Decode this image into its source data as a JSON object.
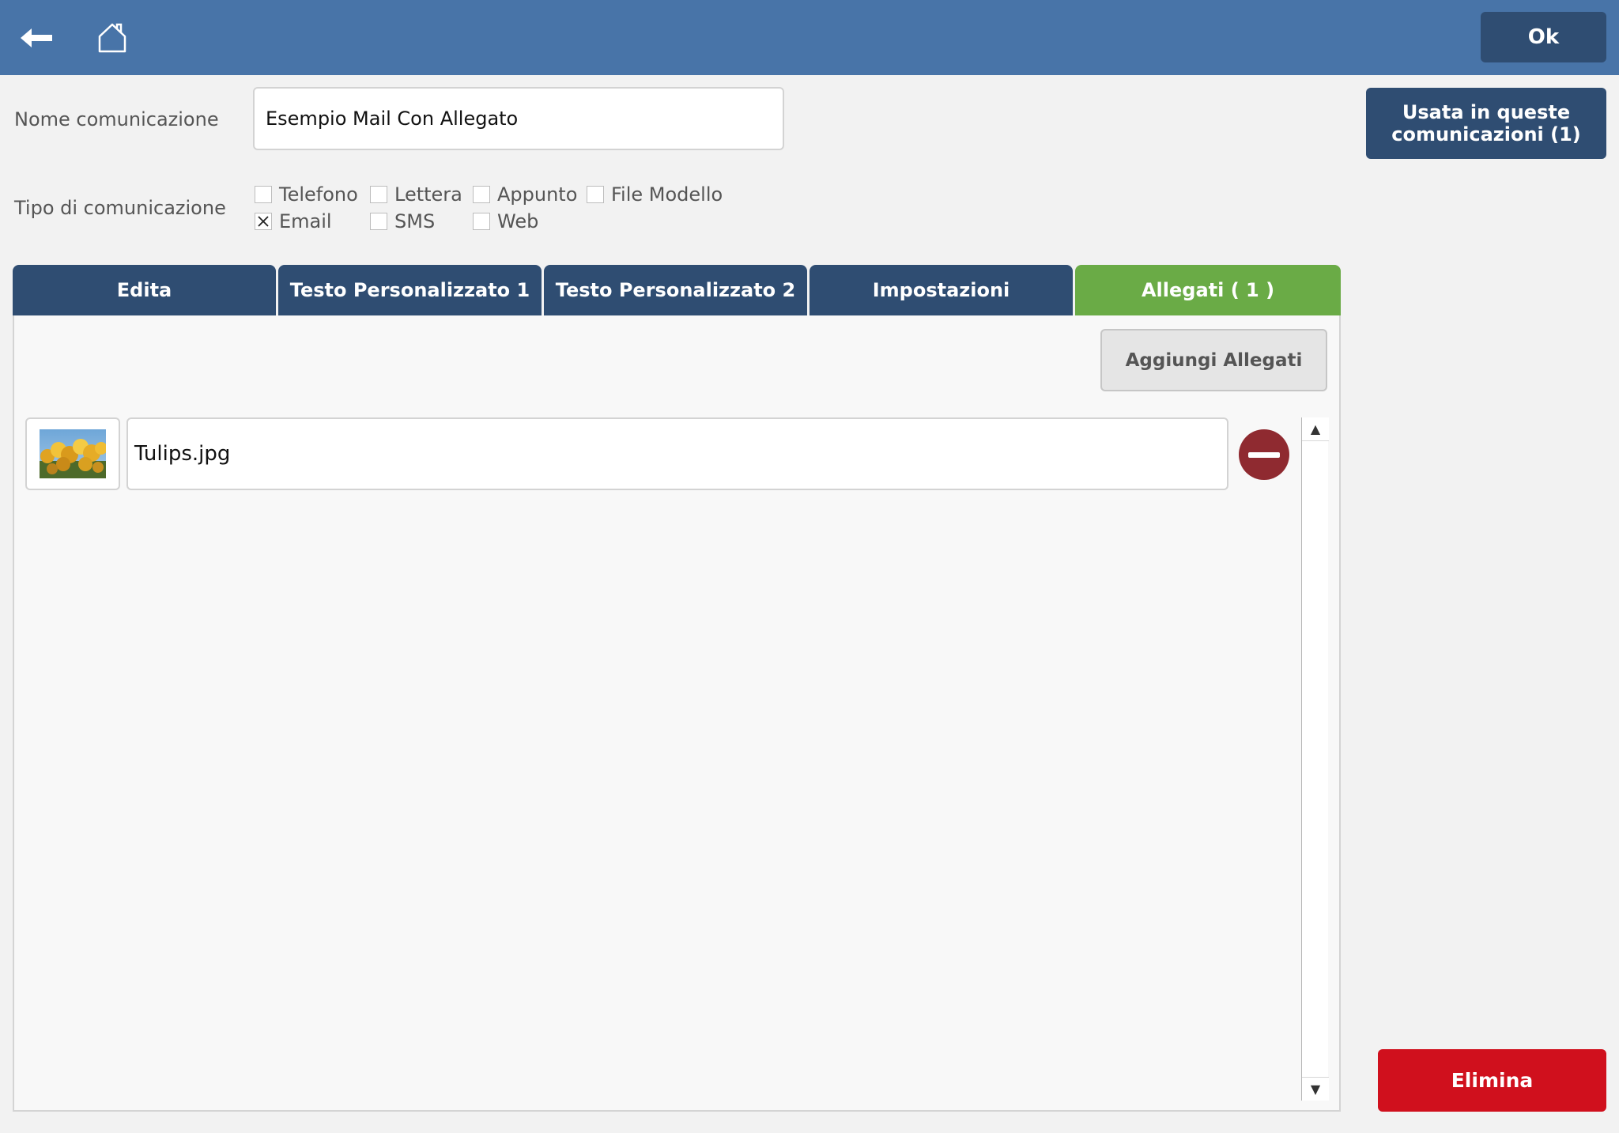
{
  "toolbar": {
    "back_icon": "arrow-left-icon",
    "home_icon": "home-icon",
    "ok_label": "Ok"
  },
  "form": {
    "name_label": "Nome comunicazione",
    "name_value": "Esempio Mail Con Allegato",
    "type_label": "Tipo di comunicazione",
    "used_button_label": "Usata in queste comunicazioni (1)",
    "types": [
      {
        "label": "Telefono",
        "checked": false
      },
      {
        "label": "Lettera",
        "checked": false
      },
      {
        "label": "Appunto",
        "checked": false
      },
      {
        "label": "File Modello",
        "checked": false
      },
      {
        "label": "Email",
        "checked": true
      },
      {
        "label": "SMS",
        "checked": false
      },
      {
        "label": "Web",
        "checked": false
      }
    ]
  },
  "tabs": [
    {
      "label": "Edita",
      "active": false
    },
    {
      "label": "Testo Personalizzato 1",
      "active": false
    },
    {
      "label": "Testo Personalizzato 2",
      "active": false
    },
    {
      "label": "Impostazioni",
      "active": false
    },
    {
      "label": "Allegati ( 1 )",
      "active": true
    }
  ],
  "attachments": {
    "add_label": "Aggiungi Allegati",
    "items": [
      {
        "name": "Tulips.jpg",
        "thumbnail_icon": "tulips-thumbnail",
        "remove_icon": "remove-icon"
      }
    ],
    "scroll_up_glyph": "▲",
    "scroll_down_glyph": "▼"
  },
  "footer": {
    "delete_label": "Elimina"
  },
  "colors": {
    "topbar": "#4874a8",
    "button_dark": "#2f4d72",
    "tab_active": "#6aab46",
    "delete": "#d0101d",
    "remove": "#8f2a30"
  }
}
